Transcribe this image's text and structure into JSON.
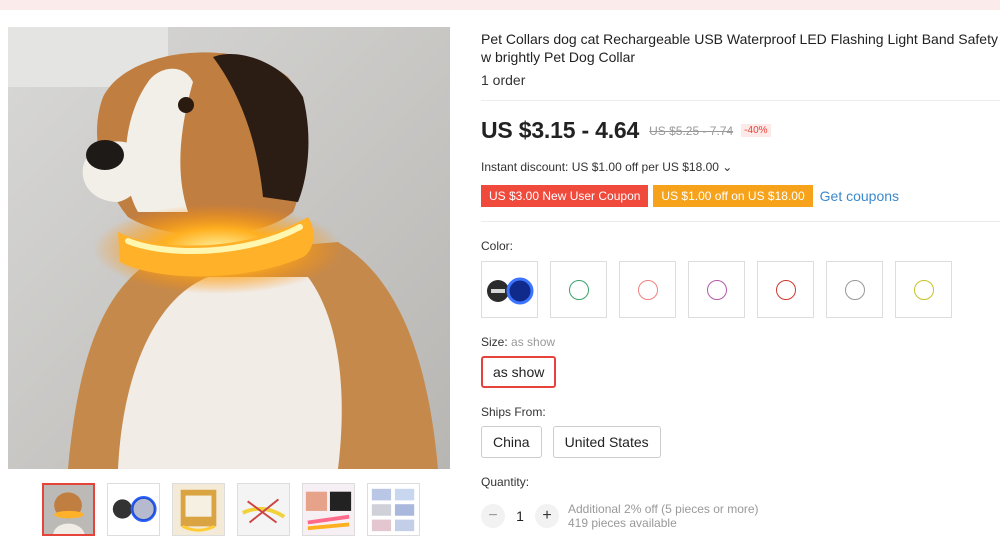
{
  "product": {
    "title": "Pet Collars dog cat Rechargeable USB Waterproof LED Flashing Light Band Safety w brightly Pet Dog Collar",
    "orders": "1 order",
    "price": "US $3.15 - 4.64",
    "original_price": "US $5.25 - 7.74",
    "discount": "-40%",
    "instant_discount": "Instant discount: US $1.00 off per US $18.00 ⌄",
    "coupons": [
      "US $3.00 New User Coupon",
      "US $1.00 off on US $18.00"
    ],
    "get_coupons": "Get coupons"
  },
  "color": {
    "label": "Color:",
    "options": [
      {
        "name": "photo",
        "color": "#1f4fd1"
      },
      {
        "name": "green",
        "color": "#3aa36b"
      },
      {
        "name": "pink",
        "color": "#f08080"
      },
      {
        "name": "purple",
        "color": "#b35aa8"
      },
      {
        "name": "red",
        "color": "#cc3a2e"
      },
      {
        "name": "white",
        "color": "#999999"
      },
      {
        "name": "yellow",
        "color": "#c8c12a"
      }
    ]
  },
  "size": {
    "label": "Size: ",
    "selected_note": "as show",
    "option": "as show"
  },
  "ships_from": {
    "label": "Ships From:",
    "options": [
      "China",
      "United States"
    ]
  },
  "quantity": {
    "label": "Quantity:",
    "minus": "−",
    "value": "1",
    "plus": "+",
    "bulk_note": "Additional 2% off (5 pieces or more)",
    "available": "419 pieces available"
  },
  "icons": {
    "minus": "minus-icon",
    "plus": "plus-icon",
    "chevron": "chevron-down-icon"
  },
  "colors": {
    "accent": "#e6443a",
    "coupon_red": "#f04a3d",
    "coupon_orange": "#f7a21b",
    "link": "#3b89cd"
  }
}
